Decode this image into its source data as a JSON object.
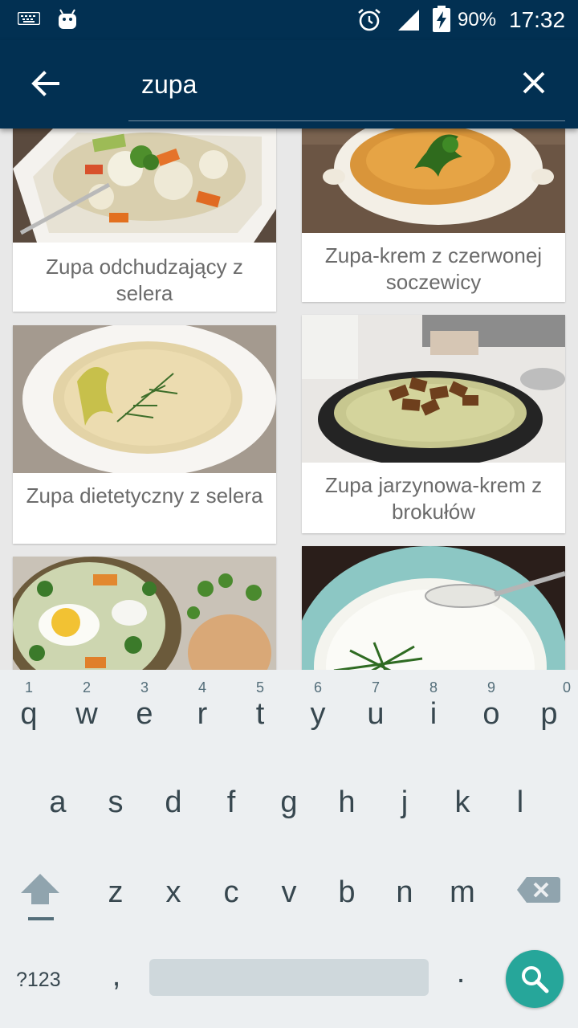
{
  "status_bar": {
    "battery_percent": "90%",
    "time": "17:32",
    "icons": [
      "keyboard-icon",
      "android-icon",
      "alarm-icon",
      "signal-icon",
      "battery-charging-icon"
    ]
  },
  "search": {
    "query": "zupa",
    "back_icon": "arrow-back-icon",
    "clear_icon": "close-icon"
  },
  "recipes": [
    {
      "title": "Zupa odchudzający z selera"
    },
    {
      "title": "Zupa-krem z czerwonej soczewicy"
    },
    {
      "title": "Zupa dietetyczny z selera"
    },
    {
      "title": "Zupa jarzynowa-krem z brokułów"
    },
    {
      "title": ""
    },
    {
      "title": ""
    }
  ],
  "keyboard": {
    "row1": [
      {
        "ch": "q",
        "hint": "1"
      },
      {
        "ch": "w",
        "hint": "2"
      },
      {
        "ch": "e",
        "hint": "3"
      },
      {
        "ch": "r",
        "hint": "4"
      },
      {
        "ch": "t",
        "hint": "5"
      },
      {
        "ch": "y",
        "hint": "6"
      },
      {
        "ch": "u",
        "hint": "7"
      },
      {
        "ch": "i",
        "hint": "8"
      },
      {
        "ch": "o",
        "hint": "9"
      },
      {
        "ch": "p",
        "hint": "0"
      }
    ],
    "row2": [
      "a",
      "s",
      "d",
      "f",
      "g",
      "h",
      "j",
      "k",
      "l"
    ],
    "row3": [
      "z",
      "x",
      "c",
      "v",
      "b",
      "n",
      "m"
    ],
    "symbols_label": "?123",
    "comma": ",",
    "period": ".",
    "accent_color": "#26a69a"
  },
  "colors": {
    "app_bar": "#023052",
    "background": "#e8e8e8",
    "keyboard": "#eceff1"
  }
}
